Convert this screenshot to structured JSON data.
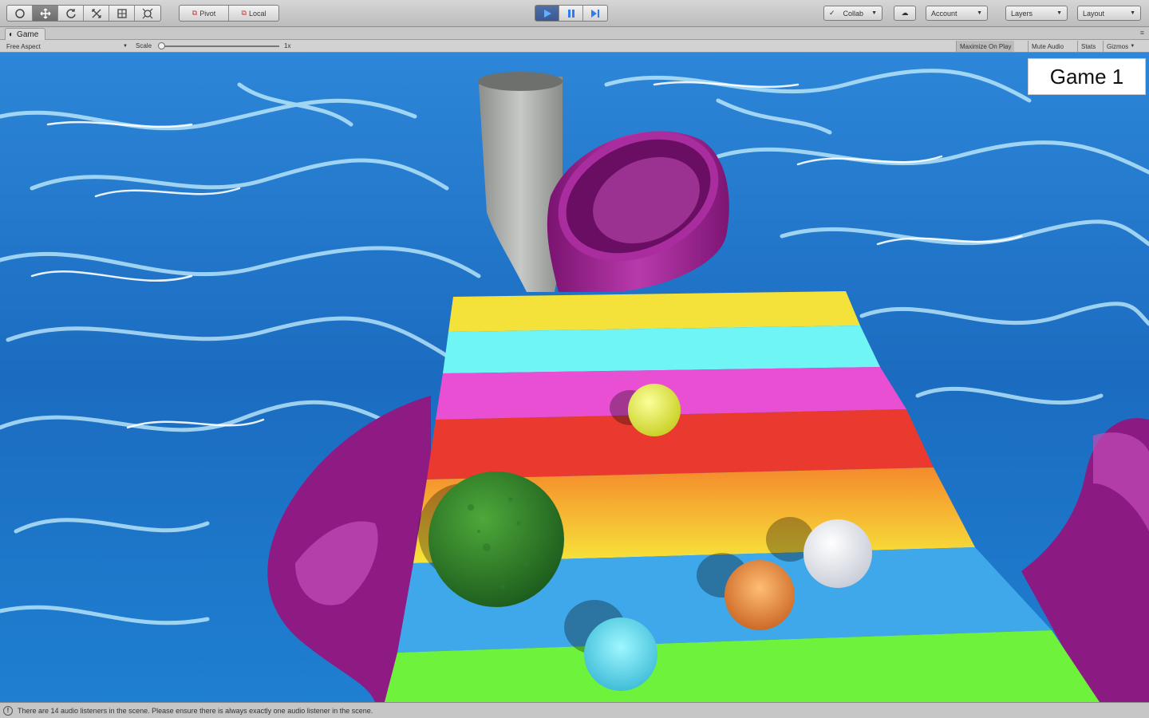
{
  "toolbar": {
    "tools": [
      {
        "name": "hand-tool",
        "icon": "hand-icon"
      },
      {
        "name": "move-tool",
        "icon": "move-icon"
      },
      {
        "name": "rotate-tool",
        "icon": "rotate-icon"
      },
      {
        "name": "scale-tool",
        "icon": "scale-icon"
      },
      {
        "name": "rect-tool",
        "icon": "rect-icon"
      },
      {
        "name": "transform-tool",
        "icon": "transform-icon"
      }
    ],
    "pivot_label": "Pivot",
    "local_label": "Local",
    "collab_label": "Collab",
    "account_label": "Account",
    "layers_label": "Layers",
    "layout_label": "Layout"
  },
  "tab": {
    "title": "Game"
  },
  "gamebar": {
    "aspect": "Free Aspect",
    "scale_label": "Scale",
    "scale_value": "1x",
    "maximize_on_play": "Maximize On Play",
    "mute_audio": "Mute Audio",
    "stats": "Stats",
    "gizmos": "Gizmos"
  },
  "game": {
    "label": "Game 1"
  },
  "status": {
    "message": "There are 14 audio listeners in the scene. Please ensure there is always exactly one audio listener in the scene."
  },
  "colors": {
    "water": "#1f6fc4",
    "tube": "#9b1f8f",
    "pipe": "#a7a9a6",
    "stripes": [
      "#f5e53a",
      "#6ff6f4",
      "#e94fd2",
      "#ea3a30",
      "#f4c63c",
      "#3fa8ea",
      "#6ff23c"
    ]
  }
}
